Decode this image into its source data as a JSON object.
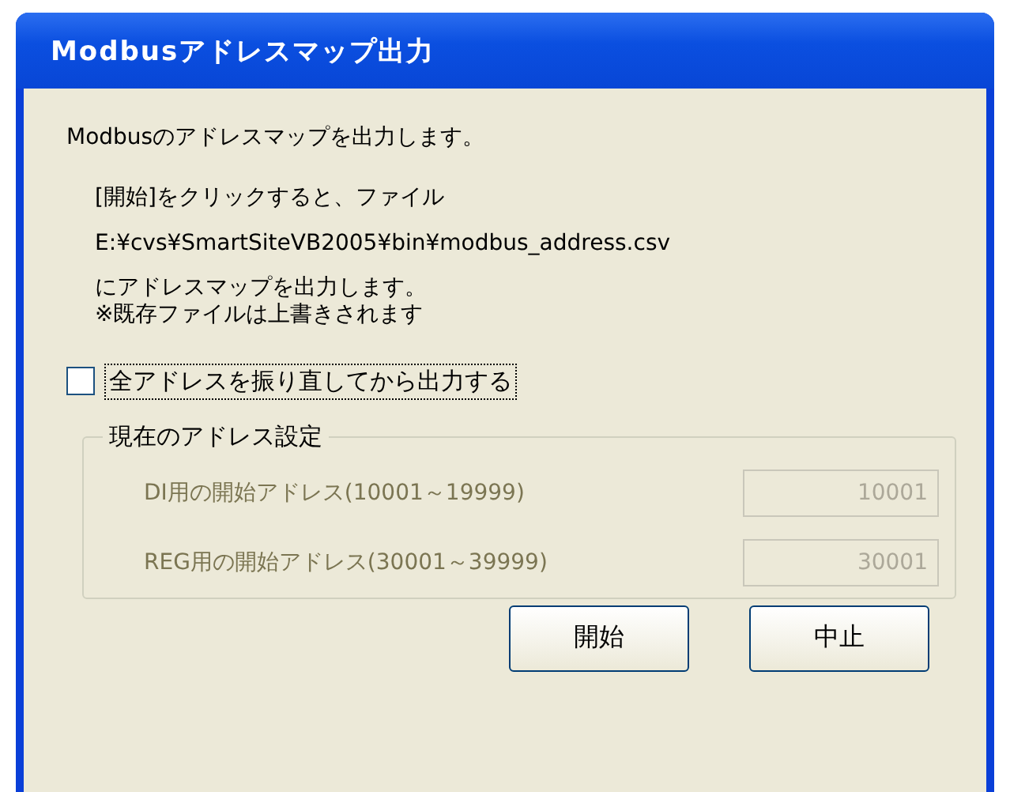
{
  "window": {
    "title": "Modbusアドレスマップ出力"
  },
  "intro": "Modbusのアドレスマップを出力します。",
  "message": [
    "[開始]をクリックすると、ファイル",
    "E:¥cvs¥SmartSiteVB2005¥bin¥modbus_address.csv"
  ],
  "note": [
    "にアドレスマップを出力します。",
    "※既存ファイルは上書きされます"
  ],
  "checkbox": {
    "label": "全アドレスを振り直してから出力する",
    "checked": false,
    "focused": true
  },
  "group": {
    "title": "現在のアドレス設定",
    "rows": [
      {
        "label": "DI用の開始アドレス(10001～19999)",
        "value": "10001",
        "disabled": true
      },
      {
        "label": "REG用の開始アドレス(30001～39999)",
        "value": "30001",
        "disabled": true
      }
    ]
  },
  "buttons": [
    "開始",
    "中止"
  ]
}
